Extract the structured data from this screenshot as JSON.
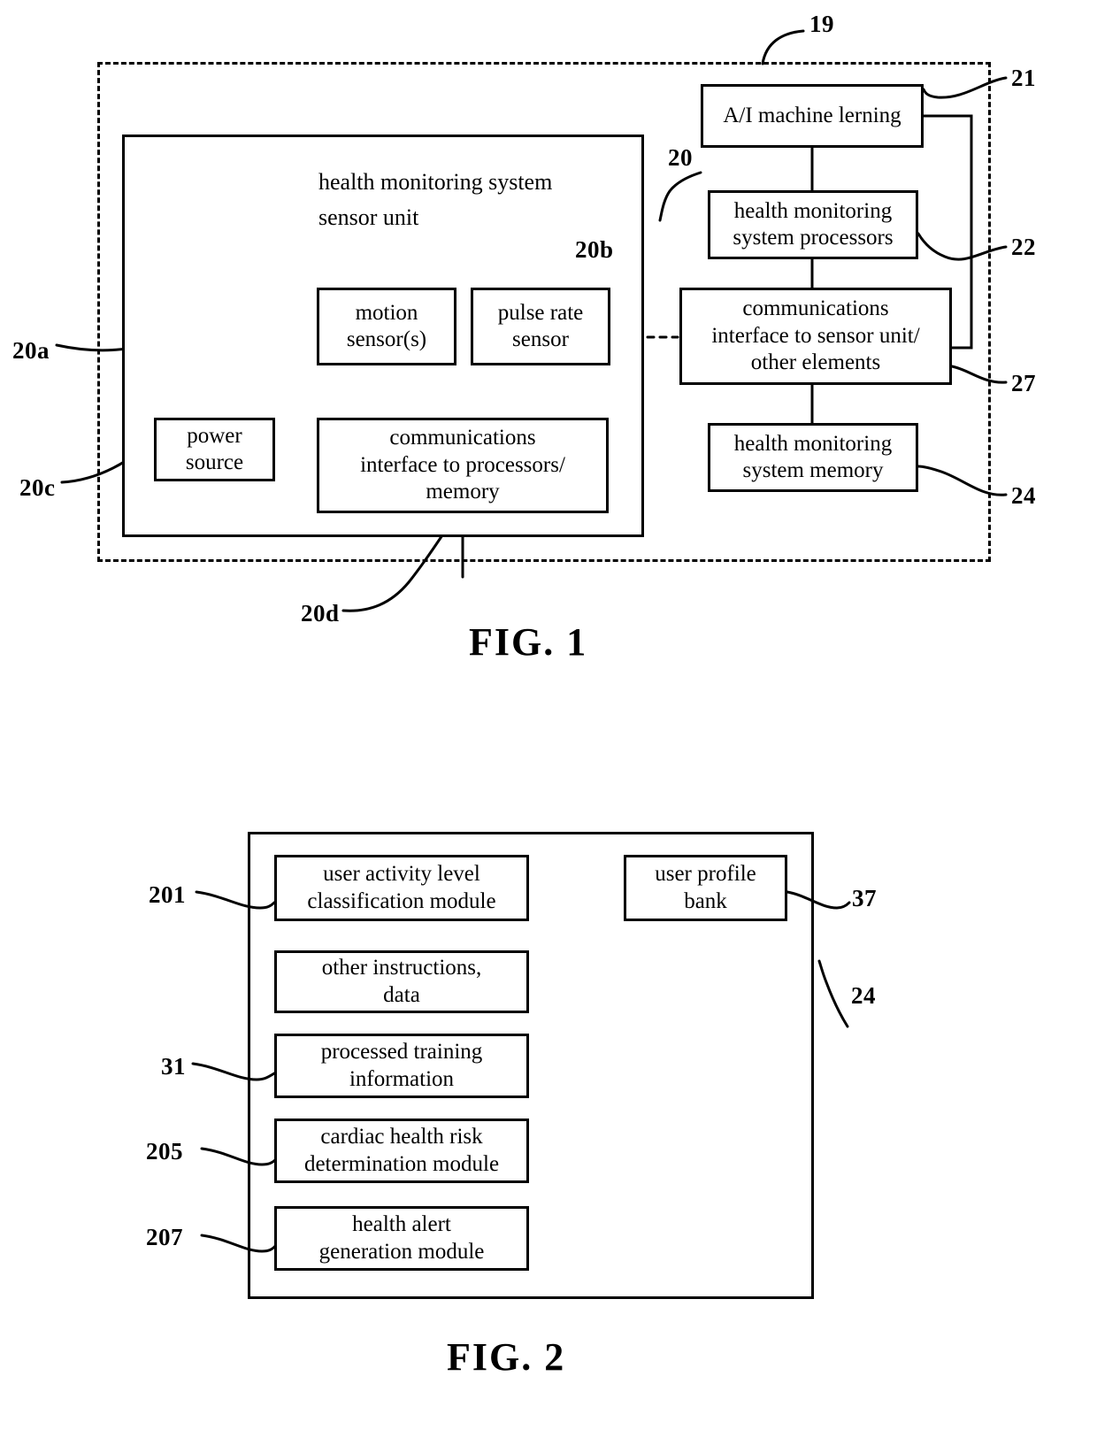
{
  "document": {
    "type": "patent-drawing-sheet"
  },
  "figure1": {
    "caption": "FIG.  1",
    "system_ref": "19",
    "sensor_unit": {
      "title_line1": "health monitoring system",
      "title_line2": "sensor unit",
      "ref": "20",
      "blocks": [
        {
          "id": "motion-sensors",
          "line1": "motion",
          "line2": "sensor(s)",
          "ref": "20a"
        },
        {
          "id": "pulse-rate-sensor",
          "line1": "pulse rate",
          "line2": "sensor",
          "ref": "20b"
        },
        {
          "id": "power-source",
          "line1": "power",
          "line2": "source",
          "ref": "20c"
        },
        {
          "id": "comms-interface-processors",
          "line1": "communications",
          "line2": "interface to processors/",
          "line3": "memory",
          "ref": "20d"
        }
      ]
    },
    "processing_side": {
      "blocks": [
        {
          "id": "ai-machine-learning",
          "line1": "A/I machine lerning",
          "ref": "21"
        },
        {
          "id": "hms-processors",
          "line1": "health monitoring",
          "line2": "system processors",
          "ref": "22"
        },
        {
          "id": "comms-interface-sensor-unit",
          "line1": "communications",
          "line2": "interface to sensor unit/",
          "line3": "other elements",
          "ref": "27"
        },
        {
          "id": "hms-memory",
          "line1": "health monitoring",
          "line2": "system memory",
          "ref": "24"
        }
      ]
    }
  },
  "figure2": {
    "caption": "FIG.  2",
    "memory_ref": "24",
    "left_column": [
      {
        "id": "user-activity-level-classification-module",
        "line1": "user activity level",
        "line2": "classification module",
        "ref": "201"
      },
      {
        "id": "other-instructions-data",
        "line1": "other instructions,",
        "line2": "data",
        "ref": ""
      },
      {
        "id": "processed-training-information",
        "line1": "processed training",
        "line2": "information",
        "ref": "31"
      },
      {
        "id": "cardiac-health-risk-determination-module",
        "line1": "cardiac health risk",
        "line2": "determination module",
        "ref": "205"
      },
      {
        "id": "health-alert-generation-module",
        "line1": "health alert",
        "line2": "generation module",
        "ref": "207"
      }
    ],
    "right_column": [
      {
        "id": "user-profile-bank",
        "line1": "user profile",
        "line2": "bank",
        "ref": "37"
      }
    ]
  }
}
